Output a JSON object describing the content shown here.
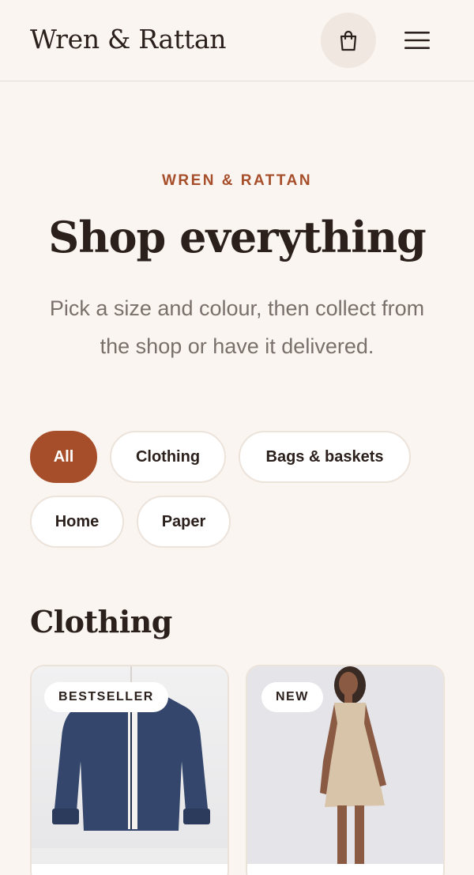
{
  "header": {
    "brand": "Wren & Rattan",
    "cart_icon": "shopping-bag-icon",
    "menu_icon": "hamburger-menu-icon"
  },
  "hero": {
    "eyebrow": "WREN & RATTAN",
    "title": "Shop everything",
    "subtitle": "Pick a size and colour, then collect from the shop or have it delivered."
  },
  "filters": [
    {
      "label": "All",
      "active": true
    },
    {
      "label": "Clothing",
      "active": false
    },
    {
      "label": "Bags & baskets",
      "active": false
    },
    {
      "label": "Home",
      "active": false
    },
    {
      "label": "Paper",
      "active": false
    }
  ],
  "sections": [
    {
      "title": "Clothing",
      "products": [
        {
          "badge": "BESTSELLER",
          "image": "navy-linen-shirt-image"
        },
        {
          "badge": "NEW",
          "image": "beige-linen-dress-image"
        }
      ]
    }
  ],
  "colors": {
    "background": "#faf5f0",
    "accent": "#a64e2a",
    "text": "#2b201c",
    "muted": "#7a706b"
  }
}
